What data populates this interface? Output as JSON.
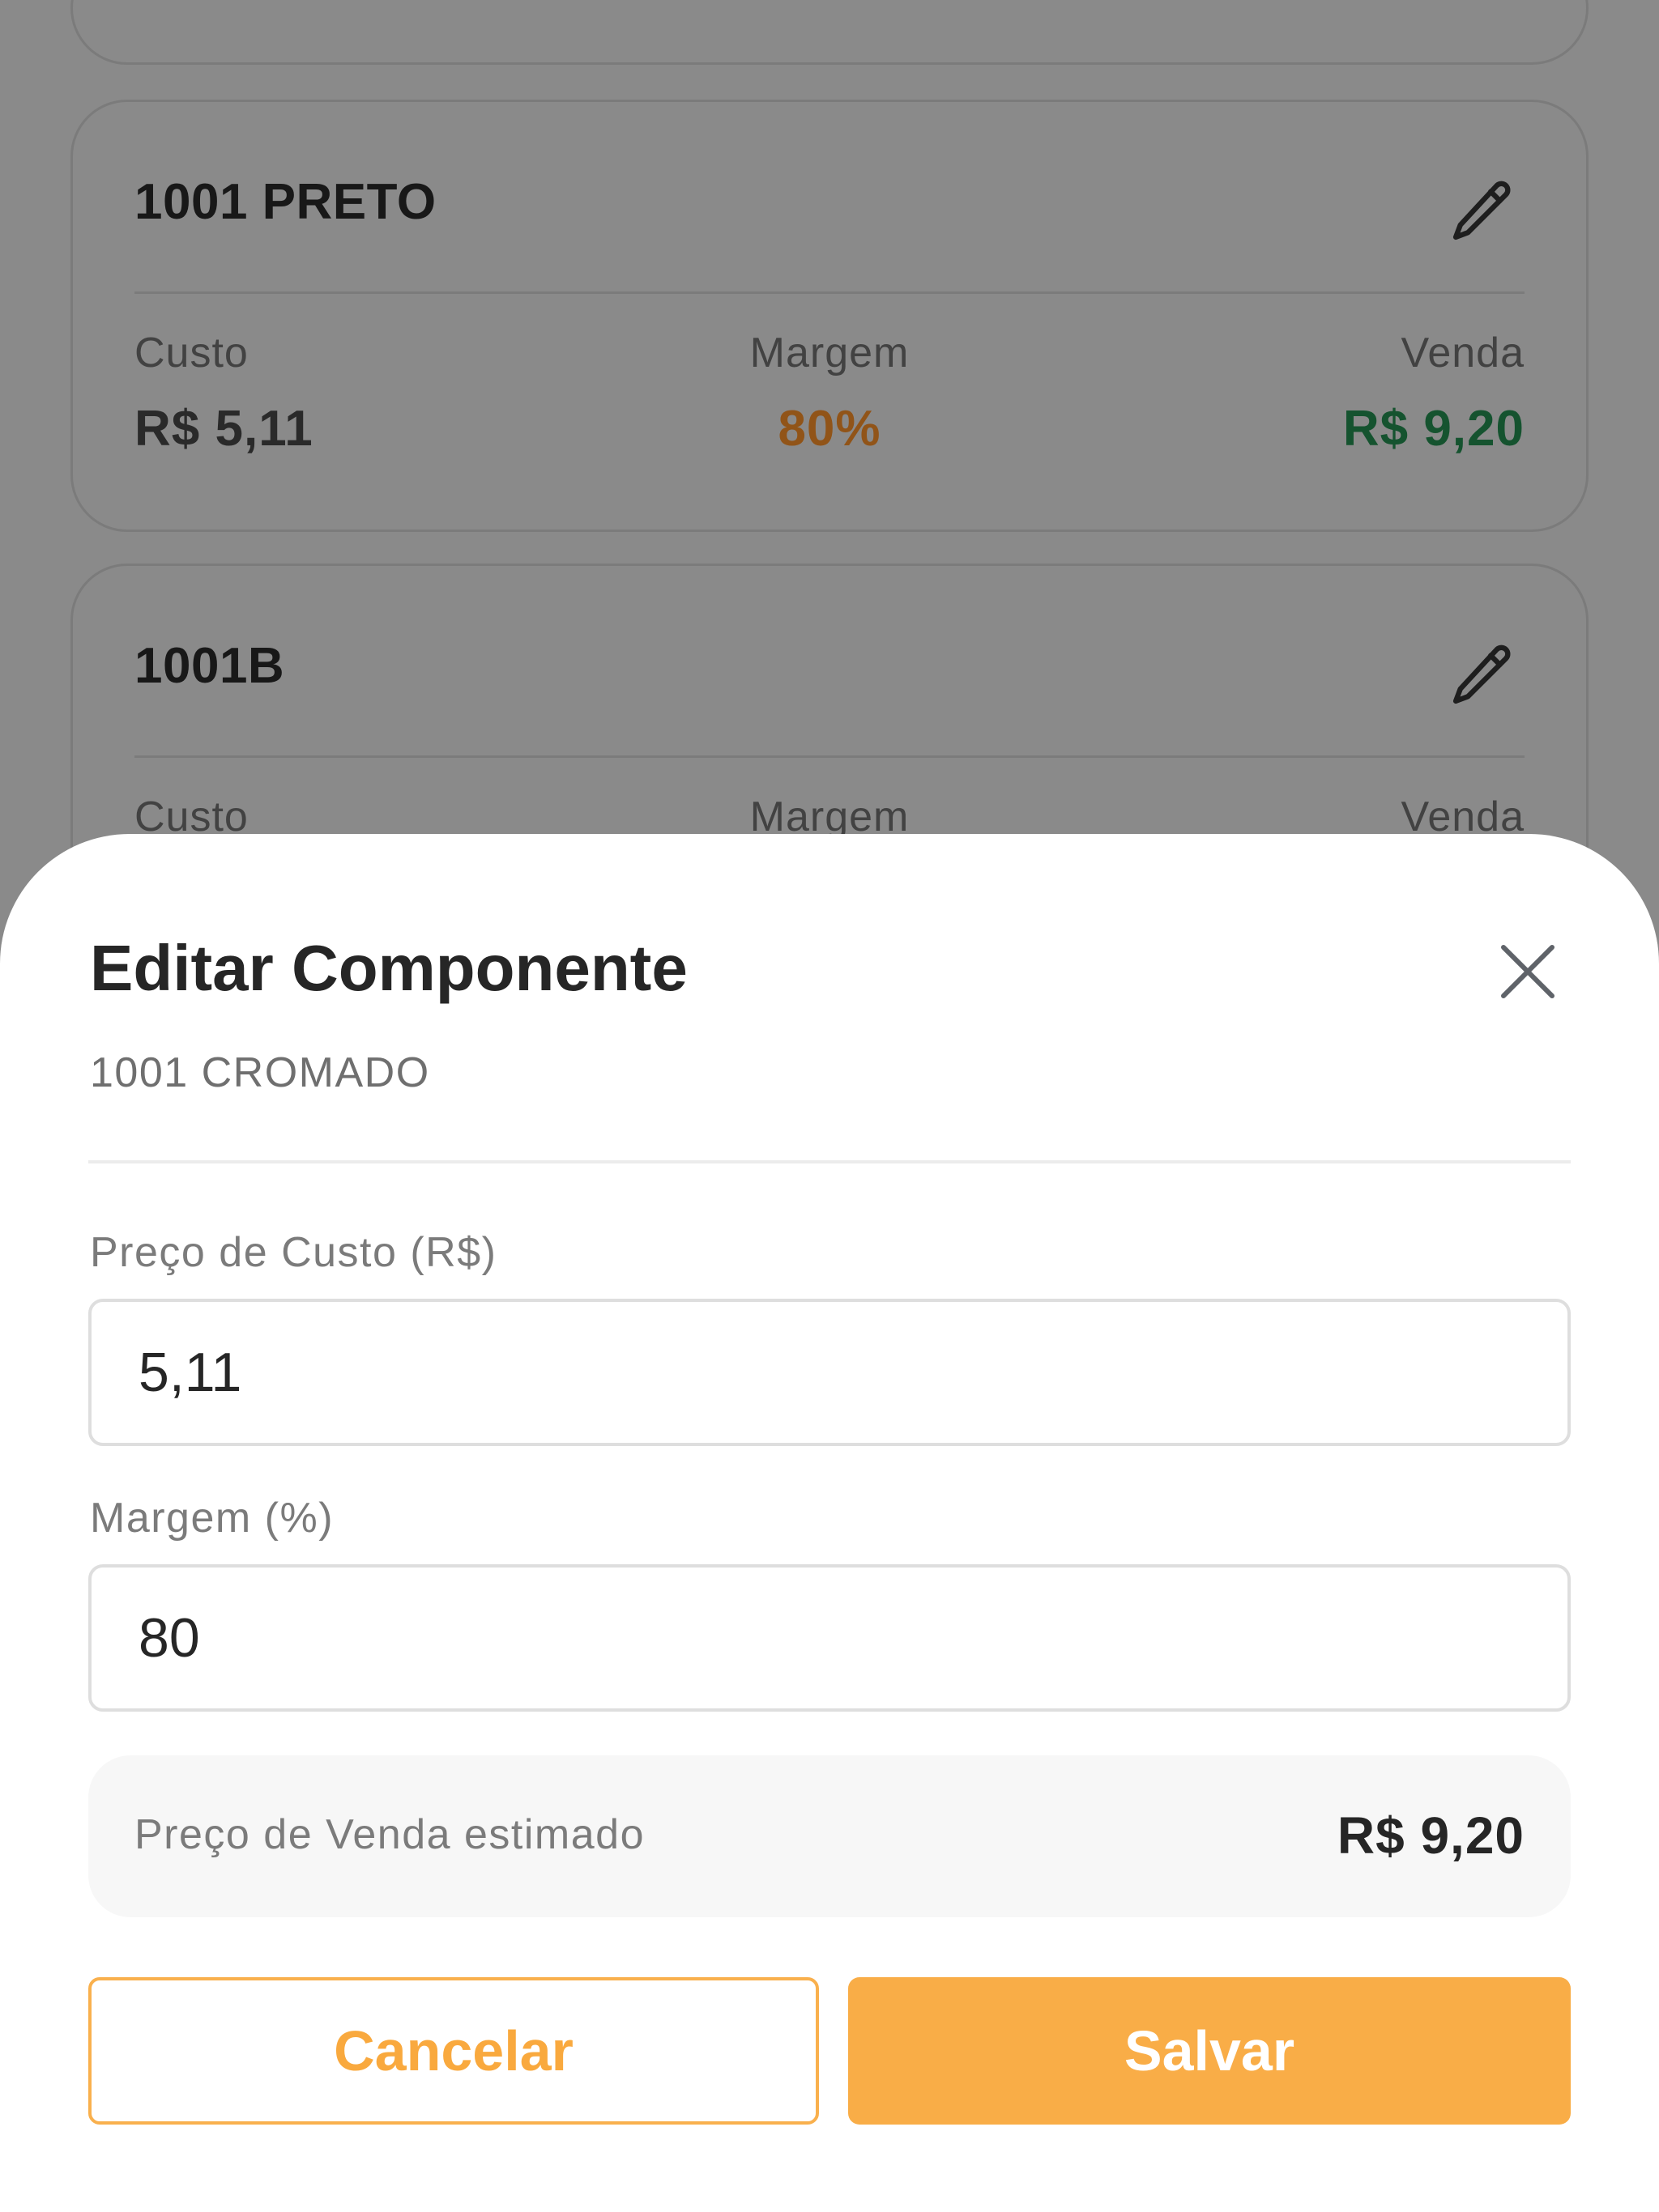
{
  "background_list": {
    "cards": [
      {
        "title": "1001 PRETO",
        "cost_label": "Custo",
        "cost_value": "R$ 5,11",
        "margin_label": "Margem",
        "margin_value": "80%",
        "sale_label": "Venda",
        "sale_value": "R$ 9,20",
        "edit_icon": "pencil-icon"
      },
      {
        "title": "1001B",
        "cost_label": "Custo",
        "margin_label": "Margem",
        "sale_label": "Venda",
        "edit_icon": "pencil-icon"
      }
    ]
  },
  "sheet": {
    "title": "Editar Componente",
    "subtitle": "1001 CROMADO",
    "close_icon": "close-icon",
    "cost_field": {
      "label": "Preço de Custo (R$)",
      "value": "5,11"
    },
    "margin_field": {
      "label": "Margem (%)",
      "value": "80"
    },
    "estimate": {
      "label": "Preço de Venda estimado",
      "value": "R$ 9,20"
    },
    "cancel_label": "Cancelar",
    "save_label": "Salvar"
  },
  "colors": {
    "overlay": "#8a8a8a",
    "accent": "#f9ad47",
    "margin_text": "#915418",
    "sale_text": "#15532f"
  }
}
